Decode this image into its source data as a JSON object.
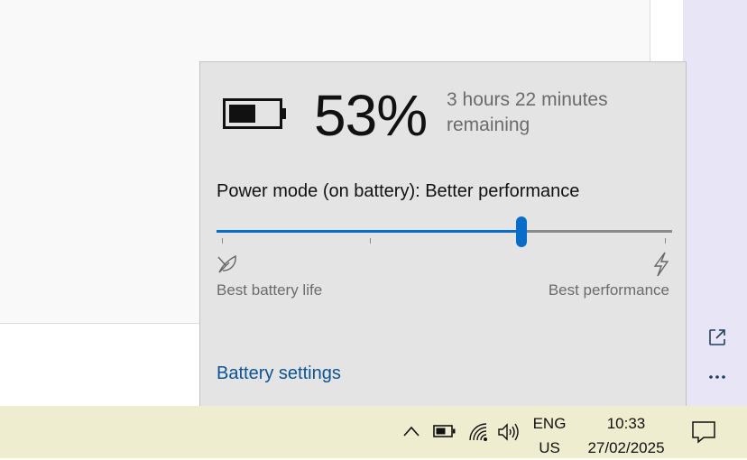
{
  "battery": {
    "percent": "53%",
    "level": 0.53,
    "remaining": "3 hours 22 minutes remaining"
  },
  "power_mode": {
    "label": "Power mode (on battery): Better performance",
    "position": 0.67,
    "left_label": "Best battery life",
    "right_label": "Best performance"
  },
  "settings_link": "Battery settings",
  "taskbar": {
    "lang_top": "ENG",
    "lang_bottom": "US",
    "time": "10:33",
    "date": "27/02/2025"
  },
  "colors": {
    "accent": "#0a6cc9",
    "flyout_bg": "#e4e4e4",
    "taskbar_bg": "#efedcf",
    "link": "#0b5394"
  },
  "icons": [
    "battery-icon",
    "leaf-icon",
    "lightning-icon",
    "open-external-icon",
    "more-icon",
    "chevron-up-icon",
    "taskbar-battery-icon",
    "wifi-icon",
    "speaker-icon",
    "notification-icon"
  ]
}
